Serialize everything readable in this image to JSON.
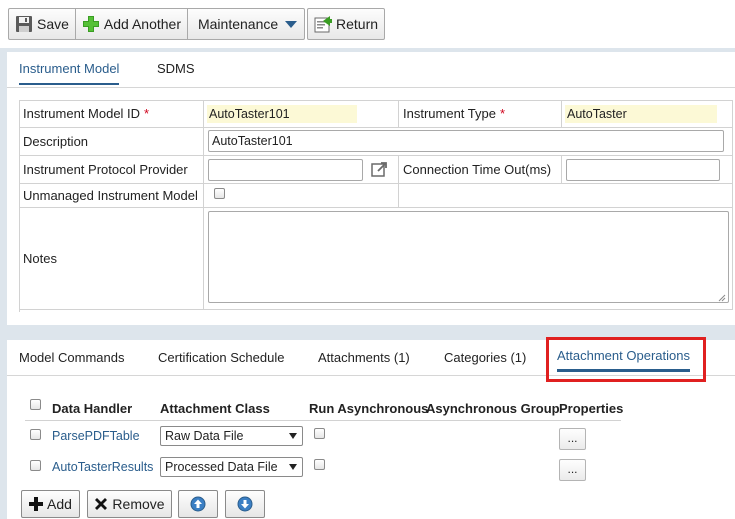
{
  "toolbar": {
    "save_label": "Save",
    "add_another_label": "Add Another",
    "maintenance_label": "Maintenance",
    "return_label": "Return"
  },
  "top_tabs": [
    {
      "label": "Instrument Model",
      "active": true
    },
    {
      "label": "SDMS",
      "active": false
    }
  ],
  "form": {
    "model_id_label": "Instrument Model ID",
    "model_id_value": "AutoTaster101",
    "type_label": "Instrument Type",
    "type_value": "AutoTaster",
    "required_mark": "*",
    "description_label": "Description",
    "description_value": "AutoTaster101",
    "protocol_label": "Instrument Protocol Provider",
    "protocol_value": "",
    "timeout_label": "Connection Time Out(ms)",
    "timeout_value": "",
    "unmanaged_label": "Unmanaged Instrument Model",
    "unmanaged_checked": false,
    "notes_label": "Notes",
    "notes_value": ""
  },
  "bottom_tabs": [
    {
      "label": "Model Commands",
      "active": false
    },
    {
      "label": "Certification Schedule",
      "active": false
    },
    {
      "label": "Attachments (1)",
      "active": false
    },
    {
      "label": "Categories (1)",
      "active": false
    },
    {
      "label": "Attachment Operations",
      "active": true,
      "highlighted": true
    }
  ],
  "grid": {
    "columns": [
      "Data Handler",
      "Attachment Class",
      "Run Asynchronous",
      "Asynchronous Group",
      "Properties"
    ],
    "rows": [
      {
        "data_handler": "ParsePDFTable",
        "attachment_class": "Raw Data File",
        "run_async": false,
        "async_group": "",
        "properties_button": "..."
      },
      {
        "data_handler": "AutoTasterResults",
        "attachment_class": "Processed Data File",
        "run_async": false,
        "async_group": "",
        "properties_button": "..."
      }
    ]
  },
  "grid_buttons": {
    "add_label": "Add",
    "remove_label": "Remove"
  },
  "colors": {
    "accent": "#2a5d8c",
    "highlight_box": "#e02020",
    "readonly_bg": "#fcf9d6",
    "required": "#d0021b",
    "add_icon": "#3a9d23"
  },
  "icons": [
    "save-icon",
    "add-icon",
    "dropdown-arrow-icon",
    "return-icon",
    "external-link-icon",
    "plus-icon",
    "x-icon",
    "arrow-up-icon",
    "arrow-down-icon"
  ]
}
